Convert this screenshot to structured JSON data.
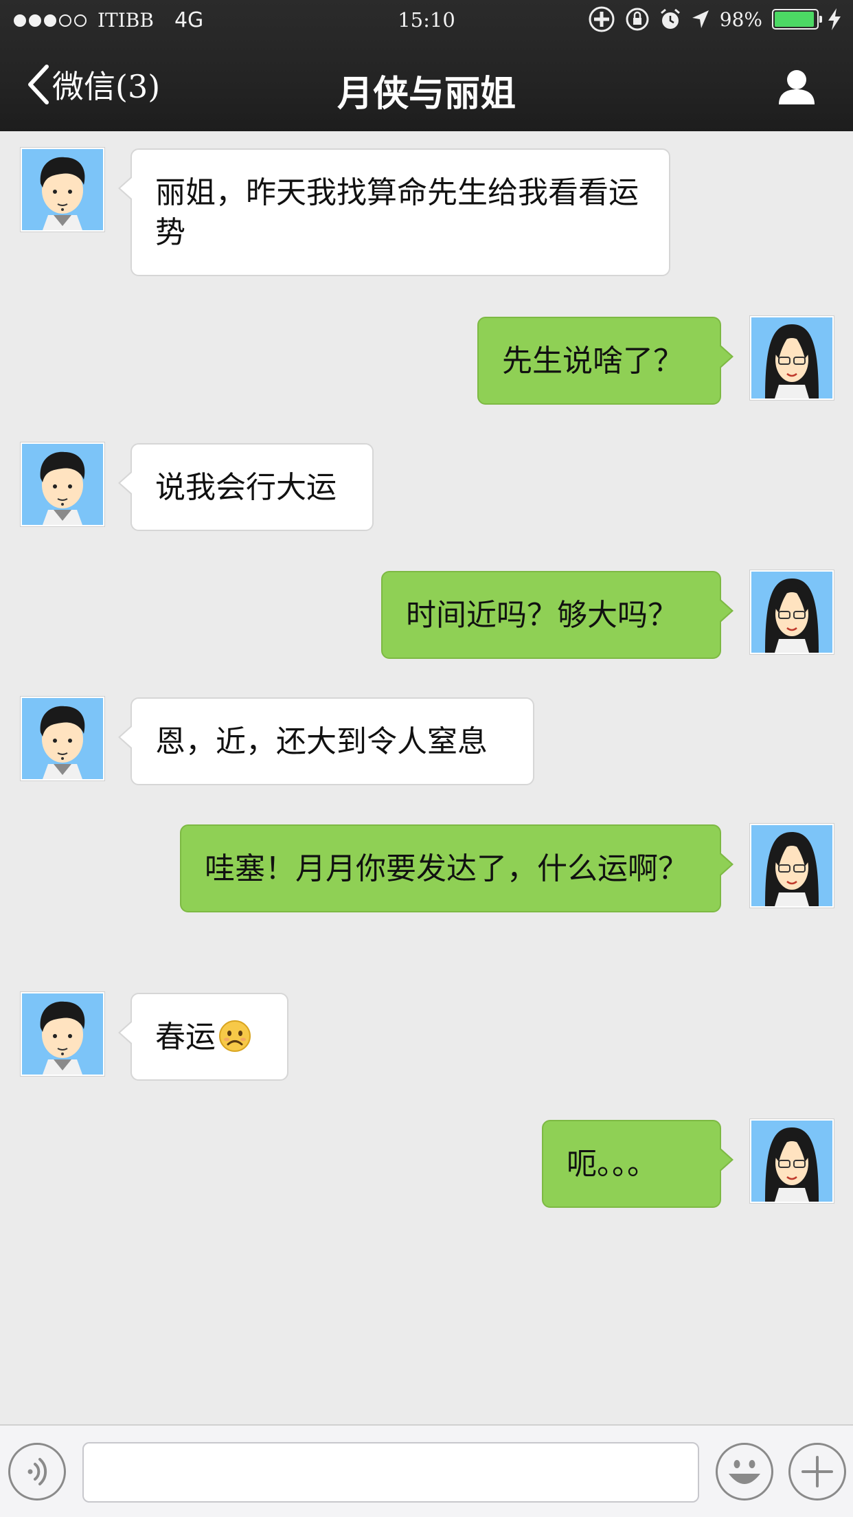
{
  "status_bar": {
    "carrier": "ITIBB",
    "network": "4G",
    "time": "15:10",
    "battery": "98%",
    "signal_strength": "3 of 5 dots"
  },
  "nav": {
    "back_label": "微信(3)",
    "title": "月侠与丽姐"
  },
  "messages": [
    {
      "side": "left",
      "text": "丽姐，昨天我找算命先生给我看看运势"
    },
    {
      "side": "right",
      "text": "先生说啥了？"
    },
    {
      "side": "left",
      "text": "说我会行大运"
    },
    {
      "side": "right",
      "text": "时间近吗？够大吗？"
    },
    {
      "side": "left",
      "text": "恩，近，还大到令人窒息"
    },
    {
      "side": "right",
      "text": "哇塞！月月你要发达了，什么运啊？"
    },
    {
      "side": "left",
      "text": "春运",
      "emoji": "sad-face-emoji"
    },
    {
      "side": "right",
      "text": "呃。。。"
    }
  ],
  "input_bar": {
    "voice_icon": "voice-icon",
    "emoji_icon": "smiley-icon",
    "more_icon": "plus-icon",
    "text_value": ""
  },
  "colors": {
    "nav_bg": "#242424",
    "chat_bg": "#ebebeb",
    "bubble_right": "#8fd055",
    "bubble_left": "#ffffff",
    "battery": "#4cd964",
    "avatar_bg": "#7cc4f8"
  }
}
